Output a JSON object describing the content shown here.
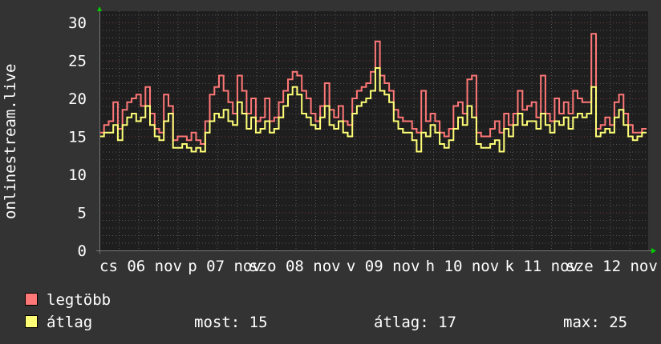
{
  "chart_data": {
    "type": "line",
    "ylabel": "onlinestream.live",
    "ylim": [
      0,
      31.5
    ],
    "yticks": [
      0,
      5,
      10,
      15,
      20,
      25,
      30
    ],
    "xtick_labels": [
      "cs 06 nov",
      "p 07 nov",
      "szo 08 nov",
      "v 09 nov",
      "h 10 nov",
      "k 11 nov",
      "sze 12 nov"
    ],
    "grid": true,
    "colors": {
      "background": "#333333",
      "plot": "#1e1e1e",
      "grid_minor": "#555555",
      "grid_major": "#7a3a3a",
      "axis_arrow": "#00cc00"
    },
    "series": [
      {
        "name": "legtöbb",
        "color": "#ff7777",
        "values": [
          15.5,
          16.5,
          17,
          19.5,
          16,
          18.5,
          19.5,
          20,
          20.5,
          19,
          21.5,
          18,
          16,
          15.5,
          20.5,
          19,
          14.5,
          15,
          15,
          14.5,
          15.5,
          14.5,
          14,
          17,
          20.5,
          21.5,
          23,
          21,
          19.5,
          18,
          23,
          21,
          18,
          20,
          17,
          17.5,
          20,
          17,
          17.5,
          19.5,
          21,
          22.5,
          23.5,
          23,
          21,
          20,
          18,
          17,
          19,
          22,
          18.5,
          17.5,
          19,
          17,
          16.5,
          20,
          21,
          21.5,
          22,
          23.5,
          27.5,
          23,
          22,
          21,
          18.5,
          17.5,
          17,
          17,
          16,
          15.5,
          21,
          17,
          18,
          17,
          15.5,
          15,
          16,
          19,
          19.5,
          18,
          22.5,
          23,
          15.5,
          15,
          15,
          16,
          17,
          15.5,
          18,
          16.5,
          18,
          21,
          18.5,
          19,
          19.5,
          17.5,
          23,
          18,
          17,
          20,
          18,
          19.5,
          18,
          21,
          20,
          19.5,
          19.5,
          28.5,
          16,
          16.5,
          17.5,
          16.5,
          19.5,
          20.5,
          18,
          16.5,
          15.5,
          15.5,
          16
        ]
      },
      {
        "name": "átlag",
        "color": "#ffff77",
        "values": [
          15,
          15.5,
          15.5,
          16.5,
          14.5,
          16.5,
          17.5,
          18,
          17,
          17.5,
          19,
          16.5,
          15,
          14.5,
          17,
          18,
          13.5,
          13.5,
          14,
          13.5,
          13,
          13.5,
          13,
          15.5,
          17,
          18,
          17.5,
          18.5,
          17,
          16.5,
          19.5,
          18,
          16,
          17.5,
          15.5,
          16,
          17,
          15.5,
          16,
          17.5,
          19,
          20.5,
          21.5,
          20.5,
          18,
          17.5,
          16.5,
          16,
          17.5,
          19,
          16.5,
          16,
          17,
          15.5,
          15,
          18,
          19,
          19.5,
          20,
          21,
          24,
          21,
          20.5,
          19.5,
          17,
          16,
          15.5,
          15.5,
          14.5,
          13,
          15.5,
          15,
          16.5,
          15.5,
          14,
          13.5,
          14.5,
          16,
          17.5,
          16.5,
          19,
          17.5,
          14,
          13.5,
          13.5,
          14,
          14.5,
          13,
          16,
          15,
          16.5,
          18,
          16.5,
          17,
          17,
          16,
          18,
          16.5,
          15.5,
          17,
          16.5,
          17.5,
          16,
          17.5,
          18,
          17.5,
          18,
          21.5,
          15,
          15.5,
          16,
          15.5,
          17.5,
          18.5,
          16.5,
          15,
          14.5,
          15,
          15.5
        ]
      }
    ]
  },
  "legend": {
    "max_label": "legtöbb",
    "avg_label": "átlag",
    "stats": {
      "current": "most: 15",
      "average": "átlag: 17",
      "maximum": "max: 25"
    }
  }
}
